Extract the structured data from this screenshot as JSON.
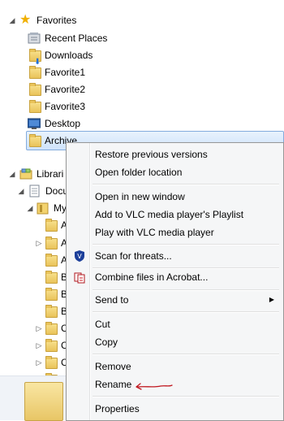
{
  "favorites": {
    "header": "Favorites",
    "items": [
      {
        "label": "Recent Places",
        "icon": "recent-places-icon"
      },
      {
        "label": "Downloads",
        "icon": "downloads-folder-icon"
      },
      {
        "label": "Favorite1",
        "icon": "folder-icon"
      },
      {
        "label": "Favorite2",
        "icon": "folder-icon"
      },
      {
        "label": "Favorite3",
        "icon": "folder-icon"
      },
      {
        "label": "Desktop",
        "icon": "desktop-icon"
      },
      {
        "label": "Archive",
        "icon": "folder-icon",
        "selected": true
      }
    ]
  },
  "libraries": {
    "header": "Librari",
    "docu": "Docu",
    "my": "My",
    "children": [
      "A",
      "A",
      "A",
      "B",
      "B",
      "B",
      "C",
      "C",
      "C",
      "C"
    ]
  },
  "context_menu": {
    "items": {
      "restore": "Restore previous versions",
      "open_location": "Open folder location",
      "open_new_window": "Open in new window",
      "vlc_add": "Add to VLC media player's Playlist",
      "vlc_play": "Play with VLC media player",
      "scan": "Scan for threats...",
      "combine": "Combine files in Acrobat...",
      "send_to": "Send to",
      "cut": "Cut",
      "copy": "Copy",
      "remove": "Remove",
      "rename": "Rename",
      "properties": "Properties"
    }
  },
  "colors": {
    "selection": "#cfe3fb",
    "menu_bg": "#f5f6f7",
    "annotation": "#c0161e"
  }
}
